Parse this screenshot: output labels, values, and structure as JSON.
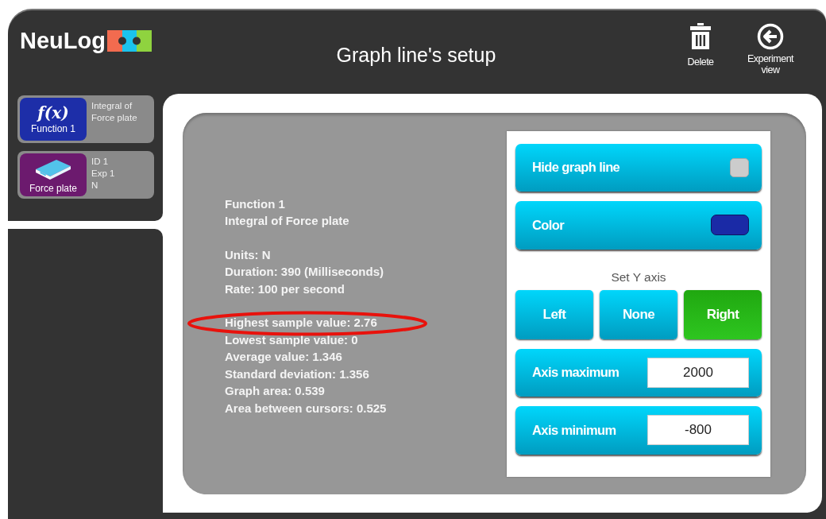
{
  "header": {
    "logo": "NeuLog",
    "title": "Graph line's setup",
    "actions": [
      {
        "kind": "delete",
        "label": "Delete"
      },
      {
        "kind": "back",
        "label": "Experiment view"
      }
    ]
  },
  "sensors": [
    {
      "kind": "function",
      "icon_text": "f(x)",
      "name": "Function 1",
      "info": [
        "Integral of Force plate"
      ]
    },
    {
      "kind": "force",
      "name": "Force plate",
      "info": [
        "ID 1",
        "Exp 1",
        "N"
      ]
    }
  ],
  "details": [
    [
      "Function 1",
      "Integral of Force plate"
    ],
    [
      "Units: N",
      "Duration: 390 (Milliseconds)",
      "Rate: 100 per second"
    ],
    [
      "Highest sample value: 2.76",
      "Lowest sample value: 0",
      "Average value: 1.346",
      "Standard deviation: 1.356",
      "Graph area: 0.539",
      "Area between cursors: 0.525"
    ]
  ],
  "settings": {
    "hide_graph_line": {
      "label": "Hide graph line",
      "checked": false
    },
    "color": {
      "label": "Color",
      "color": "#1a2aa6"
    },
    "y_axis": {
      "title": "Set Y axis",
      "options": [
        {
          "label": "Left",
          "selected": false
        },
        {
          "label": "None",
          "selected": false
        },
        {
          "label": "Right",
          "selected": true
        }
      ]
    },
    "axis_fields": [
      {
        "label": "Axis maximum",
        "value": "2000"
      },
      {
        "label": "Axis minimum",
        "value": "-800"
      }
    ]
  }
}
